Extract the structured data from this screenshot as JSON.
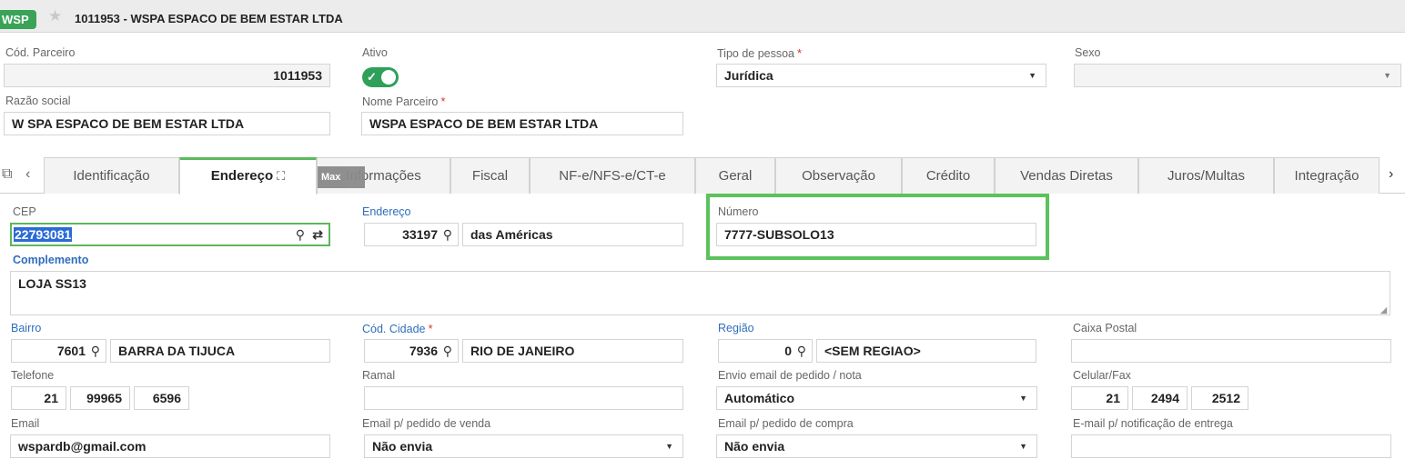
{
  "header": {
    "app_badge": "WSP",
    "star_icon": "star-icon",
    "title": "1011953 - WSPA ESPACO DE BEM ESTAR LTDA"
  },
  "partner": {
    "cod_parceiro": {
      "label": "Cód. Parceiro",
      "value": "1011953"
    },
    "ativo": {
      "label": "Ativo",
      "value": true
    },
    "tipo_pessoa": {
      "label": "Tipo de pessoa",
      "required_mark": "*",
      "value": "Jurídica"
    },
    "sexo": {
      "label": "Sexo",
      "value": ""
    },
    "razao_social": {
      "label": "Razão social",
      "value": "W SPA ESPACO DE BEM ESTAR LTDA"
    },
    "nome_parceiro": {
      "label": "Nome Parceiro",
      "required_mark": "*",
      "value": "WSPA ESPACO DE BEM ESTAR LTDA"
    }
  },
  "tabs": {
    "items": [
      {
        "label": "Identificação",
        "active": false
      },
      {
        "label": "Endereço",
        "active": true
      },
      {
        "label": "Informações",
        "active": false
      },
      {
        "label": "Fiscal",
        "active": false
      },
      {
        "label": "NF-e/NFS-e/CT-e",
        "active": false
      },
      {
        "label": "Geral",
        "active": false
      },
      {
        "label": "Observação",
        "active": false
      },
      {
        "label": "Crédito",
        "active": false
      },
      {
        "label": "Vendas Diretas",
        "active": false
      },
      {
        "label": "Juros/Multas",
        "active": false
      },
      {
        "label": "Integração ",
        "active": false
      }
    ],
    "tooltip": "Max"
  },
  "address": {
    "cep": {
      "label": "CEP",
      "value": "22793081"
    },
    "endereco": {
      "label": "Endereço",
      "code": "33197",
      "value": "das Américas"
    },
    "numero": {
      "label": "Número",
      "value": "7777-SUBSOLO13"
    },
    "complemento": {
      "label": "Complemento",
      "value": "LOJA SS13"
    },
    "bairro": {
      "label": "Bairro",
      "code": "7601",
      "value": "BARRA DA TIJUCA"
    },
    "cod_cidade": {
      "label": "Cód. Cidade",
      "required_mark": "*",
      "code": "7936",
      "value": "RIO DE JANEIRO"
    },
    "regiao": {
      "label": "Região",
      "code": "0",
      "value": "<SEM REGIAO>"
    },
    "caixa_postal": {
      "label": "Caixa Postal",
      "value": ""
    },
    "telefone": {
      "label": "Telefone",
      "ddd": "21",
      "part1": "99965",
      "part2": "6596"
    },
    "ramal": {
      "label": "Ramal",
      "value": ""
    },
    "envio_email": {
      "label": "Envio email de pedido / nota",
      "value": "Automático"
    },
    "celular": {
      "label": "Celular/Fax",
      "ddd": "21",
      "part1": "2494",
      "part2": "2512"
    },
    "email": {
      "label": "Email",
      "value": "wspardb@gmail.com"
    },
    "email_venda": {
      "label": "Email p/ pedido de venda",
      "value": "Não envia"
    },
    "email_compra": {
      "label": "Email p/ pedido de compra",
      "value": "Não envia"
    },
    "email_entrega": {
      "label": "E-mail p/ notificação de entrega",
      "value": ""
    }
  },
  "highlight_color": "#5cc25c",
  "accent_color": "#3aa357"
}
